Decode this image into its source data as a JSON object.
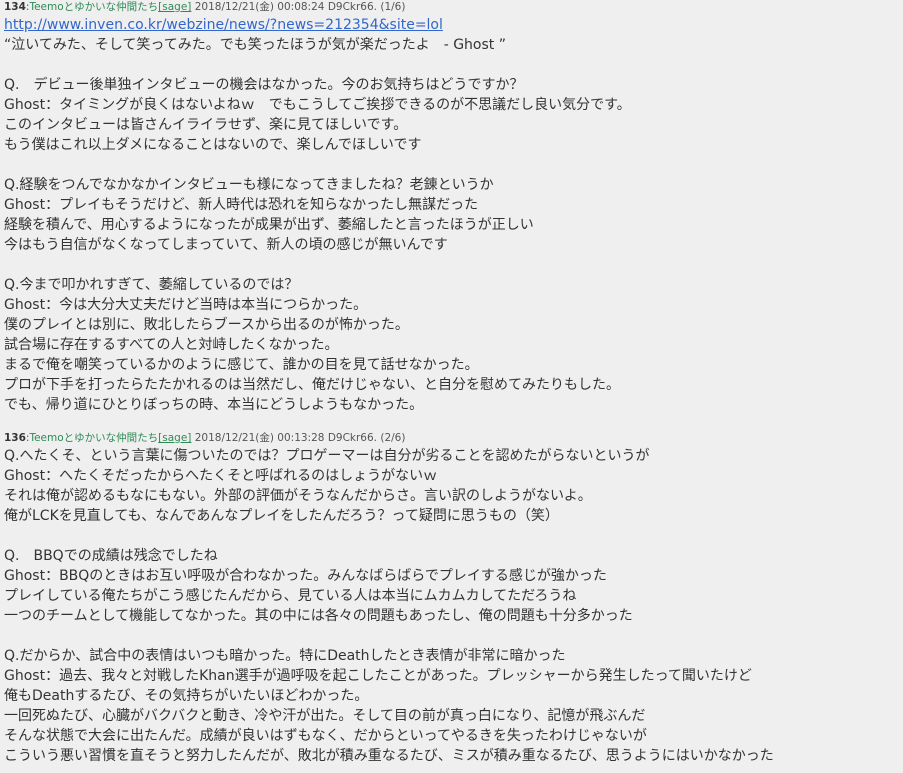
{
  "posts": [
    {
      "number": "134",
      "name": "Teemoとゆかいな仲間たち",
      "mail": "[sage]",
      "date": "2018/12/21(金) 00:08:24",
      "id": "D9Ckr66.",
      "part": "(1/6)",
      "lines": [
        "http://www.inven.co.kr/webzine/news/?news=212354&site=lol",
        "“泣いてみた、そして笑ってみた。でも笑ったほうが気が楽だったよ　- Ghost ”",
        "",
        "Q.　デビュー後単独インタビューの機会はなかった。今のお気持ちはどうですか？",
        "Ghost：タイミングが良くはないよねｗ　でもこうしてご挨拶できるのが不思議だし良い気分です。",
        "このインタビューは皆さんイライラせず、楽に見てほしいです。",
        "もう僕はこれ以上ダメになることはないので、楽しんでほしいです",
        "",
        "Q.経験をつんでなかなかインタビューも様になってきましたね？老錬というか",
        "Ghost：プレイもそうだけど、新人時代は恐れを知らなかったし無謀だった",
        "経験を積んで、用心するようになったが成果が出ず、萎縮したと言ったほうが正しい",
        "今はもう自信がなくなってしまっていて、新人の頃の感じが無いんです",
        "",
        "Q.今まで叩かれすぎて、萎縮しているのでは？",
        "Ghost：今は大分大丈夫だけど当時は本当につらかった。",
        "僕のプレイとは別に、敗北したらブースから出るのが怖かった。",
        "試合場に存在するすべての人と対峙したくなかった。",
        "まるで俺を嘲笑っているかのように感じて、誰かの目を見て話せなかった。",
        "プロが下手を打ったらたたかれるのは当然だし、俺だけじゃない、と自分を慰めてみたりもした。",
        "でも、帰り道にひとりぼっちの時、本当にどうしようもなかった。"
      ]
    },
    {
      "number": "136",
      "name": "Teemoとゆかいな仲間たち",
      "mail": "[sage]",
      "date": "2018/12/21(金) 00:13:28",
      "id": "D9Ckr66.",
      "part": "(2/6)",
      "lines": [
        "Q.へたくそ、という言葉に傷ついたのでは？プロゲーマーは自分が劣ることを認めたがらないというが",
        "Ghost：へたくそだったからへたくそと呼ばれるのはしょうがないｗ",
        "それは俺が認めるもなにもない。外部の評価がそうなんだからさ。言い訳のしようがないよ。",
        "俺がLCKを見直しても、なんであんなプレイをしたんだろう？って疑問に思うもの（笑）",
        "",
        "Q.　BBQでの成績は残念でしたね",
        "Ghost：BBQのときはお互い呼吸が合わなかった。みんなばらばらでプレイする感じが強かった",
        "プレイしている俺たちがこう感じたんだから、見ている人は本当にムカムカしてただろうね",
        "一つのチームとして機能してなかった。其の中には各々の問題もあったし、俺の問題も十分多かった",
        "",
        "Q.だからか、試合中の表情はいつも暗かった。特にDeathしたとき表情が非常に暗かった",
        "Ghost：過去、我々と対戦したKhan選手が過呼吸を起こしたことがあった。プレッシャーから発生したって聞いたけど",
        "俺もDeathするたび、その気持ちがいたいほどわかった。",
        "一回死ぬたび、心臓がバクバクと動き、冷や汗が出た。そして目の前が真っ白になり、記憶が飛ぶんだ",
        "そんな状態で大会に出たんだ。成績が良いはずもなく、だからといってやるきを失ったわけじゃないが",
        "こういう悪い習慣を直そうと努力したんだが、敗北が積み重なるたび、ミスが積み重なるたび、思うようにはいかなかった"
      ]
    }
  ]
}
